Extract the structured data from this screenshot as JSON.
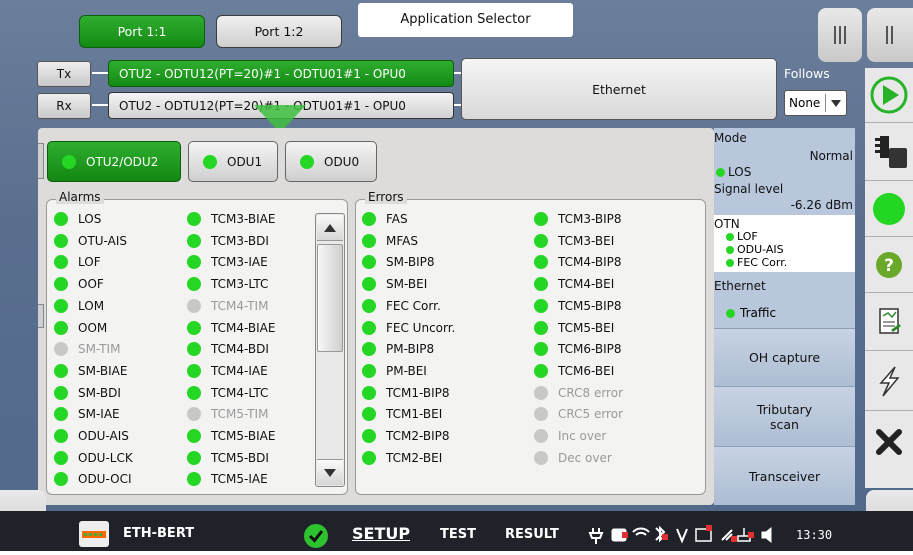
{
  "header": {
    "port_tabs": [
      "Port 1:1",
      "Port 1:2"
    ],
    "app_selector": "Application Selector"
  },
  "signal": {
    "tx_label": "Tx",
    "rx_label": "Rx",
    "tx_chain": "OTU2 - ODTU12(PT=20)#1 - ODTU01#1 - OPU0",
    "rx_chain": "OTU2 - ODTU12(PT=20)#1 - ODTU01#1 - OPU0",
    "client": "Ethernet",
    "follows_label": "Follows",
    "follows_value": "None"
  },
  "layers": [
    {
      "label": "OTU2/ODU2",
      "selected": true
    },
    {
      "label": "ODU1",
      "selected": false
    },
    {
      "label": "ODU0",
      "selected": false
    }
  ],
  "alarms": {
    "title": "Alarms",
    "col1": [
      {
        "label": "LOS",
        "active": true
      },
      {
        "label": "OTU-AIS",
        "active": true
      },
      {
        "label": "LOF",
        "active": true
      },
      {
        "label": "OOF",
        "active": true
      },
      {
        "label": "LOM",
        "active": true
      },
      {
        "label": "OOM",
        "active": true
      },
      {
        "label": "SM-TIM",
        "active": false
      },
      {
        "label": "SM-BIAE",
        "active": true
      },
      {
        "label": "SM-BDI",
        "active": true
      },
      {
        "label": "SM-IAE",
        "active": true
      },
      {
        "label": "ODU-AIS",
        "active": true
      },
      {
        "label": "ODU-LCK",
        "active": true
      },
      {
        "label": "ODU-OCI",
        "active": true
      }
    ],
    "col2": [
      {
        "label": "TCM3-BIAE",
        "active": true
      },
      {
        "label": "TCM3-BDI",
        "active": true
      },
      {
        "label": "TCM3-IAE",
        "active": true
      },
      {
        "label": "TCM3-LTC",
        "active": true
      },
      {
        "label": "TCM4-TIM",
        "active": false
      },
      {
        "label": "TCM4-BIAE",
        "active": true
      },
      {
        "label": "TCM4-BDI",
        "active": true
      },
      {
        "label": "TCM4-IAE",
        "active": true
      },
      {
        "label": "TCM4-LTC",
        "active": true
      },
      {
        "label": "TCM5-TIM",
        "active": false
      },
      {
        "label": "TCM5-BIAE",
        "active": true
      },
      {
        "label": "TCM5-BDI",
        "active": true
      },
      {
        "label": "TCM5-IAE",
        "active": true
      }
    ]
  },
  "errors": {
    "title": "Errors",
    "col1": [
      {
        "label": "FAS",
        "active": true
      },
      {
        "label": "MFAS",
        "active": true
      },
      {
        "label": "SM-BIP8",
        "active": true
      },
      {
        "label": "SM-BEI",
        "active": true
      },
      {
        "label": "FEC Corr.",
        "active": true
      },
      {
        "label": "FEC Uncorr.",
        "active": true
      },
      {
        "label": "PM-BIP8",
        "active": true
      },
      {
        "label": "PM-BEI",
        "active": true
      },
      {
        "label": "TCM1-BIP8",
        "active": true
      },
      {
        "label": "TCM1-BEI",
        "active": true
      },
      {
        "label": "TCM2-BIP8",
        "active": true
      },
      {
        "label": "TCM2-BEI",
        "active": true
      }
    ],
    "col2": [
      {
        "label": "TCM3-BIP8",
        "active": true
      },
      {
        "label": "TCM3-BEI",
        "active": true
      },
      {
        "label": "TCM4-BIP8",
        "active": true
      },
      {
        "label": "TCM4-BEI",
        "active": true
      },
      {
        "label": "TCM5-BIP8",
        "active": true
      },
      {
        "label": "TCM5-BEI",
        "active": true
      },
      {
        "label": "TCM6-BIP8",
        "active": true
      },
      {
        "label": "TCM6-BEI",
        "active": true
      },
      {
        "label": "CRC8 error",
        "active": false
      },
      {
        "label": "CRC5 error",
        "active": false
      },
      {
        "label": "Inc over",
        "active": false
      },
      {
        "label": "Dec over",
        "active": false
      }
    ]
  },
  "status_panel": {
    "mode_label": "Mode",
    "mode_value": "Normal",
    "los": "LOS",
    "signal_level_label": "Signal level",
    "signal_level_value": "-6.26 dBm",
    "otn_label": "OTN",
    "otn_items": [
      "LOF",
      "ODU-AIS",
      "FEC Corr."
    ],
    "ethernet_label": "Ethernet",
    "traffic": "Traffic",
    "buttons": [
      "OH capture",
      "Tributary\nscan",
      "Transceiver"
    ]
  },
  "bottom_bar": {
    "app_name": "ETH-BERT",
    "tabs": [
      "SETUP",
      "TEST",
      "RESULT"
    ],
    "active_tab": "SETUP",
    "time": "13:30"
  },
  "colors": {
    "green": "#25d625",
    "accent_green": "#138a13",
    "panel_blue": "#b9c7dc"
  }
}
